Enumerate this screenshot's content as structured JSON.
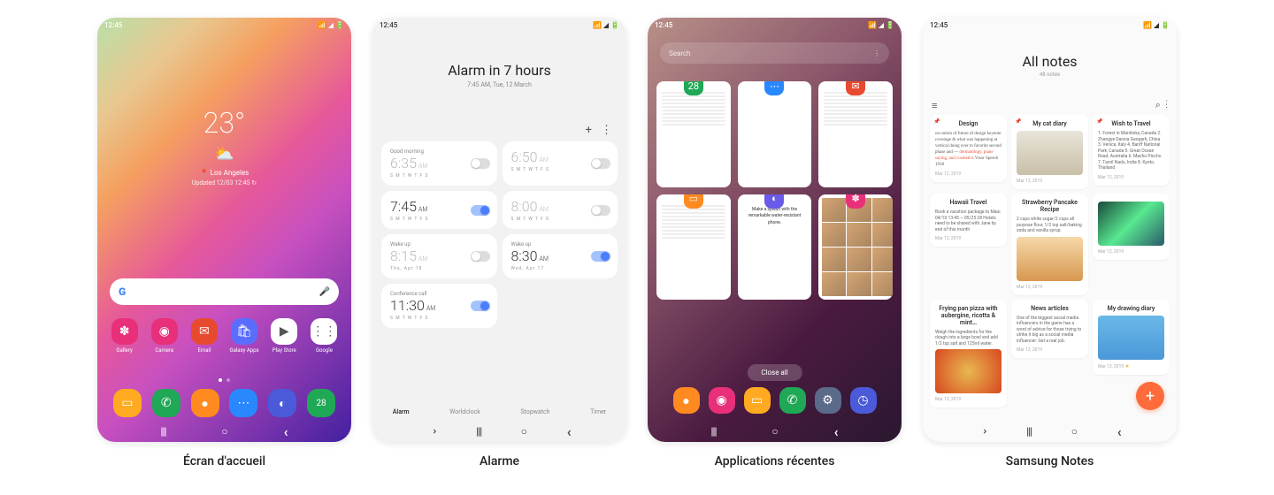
{
  "statusbar": {
    "time": "12:45"
  },
  "captions": {
    "home": "Écran d'accueil",
    "alarm": "Alarme",
    "recents": "Applications récentes",
    "notes": "Samsung Notes"
  },
  "home": {
    "weather": {
      "temp": "23°",
      "location": "Los Angeles",
      "updated": "Updated 12/03 12:45 ↻"
    },
    "apps": [
      {
        "label": "Gallery",
        "color": "#e8307a",
        "icon": "✽"
      },
      {
        "label": "Camera",
        "color": "#e8307a",
        "icon": "◉"
      },
      {
        "label": "Email",
        "color": "#e84a30",
        "icon": "✉"
      },
      {
        "label": "Galaxy Apps",
        "color": "#5a6dff",
        "icon": "🛍"
      },
      {
        "label": "Play Store",
        "color": "#fff",
        "icon": "▶"
      },
      {
        "label": "Google",
        "color": "#fff",
        "icon": "⋮⋮"
      }
    ],
    "dock": [
      {
        "color": "#ffaa20",
        "icon": "▭"
      },
      {
        "color": "#1fa855",
        "icon": "✆"
      },
      {
        "color": "#ff8a20",
        "icon": "●"
      },
      {
        "color": "#2a88ff",
        "icon": "⋯"
      },
      {
        "color": "#4a5ad8",
        "icon": "◐"
      },
      {
        "color": "#1fa855",
        "icon": "28"
      }
    ]
  },
  "alarm": {
    "title": "Alarm in 7 hours",
    "subtitle": "7:45 AM, Tue, 12 March",
    "tabs": [
      "Alarm",
      "Worldclock",
      "Stopwatch",
      "Timer"
    ],
    "activeTab": 0,
    "items": [
      {
        "label": "Good morning",
        "time": "6:35",
        "ampm": "AM",
        "days": "S M T W T F S",
        "on": false
      },
      {
        "label": "",
        "time": "6:50",
        "ampm": "AM",
        "days": "S M T W T F S",
        "on": false
      },
      {
        "label": "",
        "time": "7:45",
        "ampm": "AM",
        "days": "S M T W T F S",
        "on": true
      },
      {
        "label": "",
        "time": "8:00",
        "ampm": "AM",
        "days": "S M T W T F S",
        "on": false
      },
      {
        "label": "Wake up",
        "time": "8:15",
        "ampm": "AM",
        "days": "Thu, Apr 18",
        "on": false
      },
      {
        "label": "Wake up",
        "time": "8:30",
        "ampm": "AM",
        "days": "Wed, Apr 17",
        "on": true
      },
      {
        "label": "Conference call",
        "time": "11:30",
        "ampm": "AM",
        "days": "S M T W T F S",
        "on": true
      }
    ]
  },
  "recents": {
    "search": "Search",
    "closeAll": "Close all",
    "cards": [
      {
        "badge": "28",
        "color": "#1fa855",
        "type": "calendar"
      },
      {
        "badge": "⋯",
        "color": "#2a88ff",
        "type": "chat"
      },
      {
        "badge": "✉",
        "color": "#e84a30",
        "type": "email"
      },
      {
        "badge": "▭",
        "color": "#ff8a20",
        "type": "files"
      },
      {
        "badge": "◐",
        "color": "#6a5ae8",
        "type": "internet"
      },
      {
        "badge": "✽",
        "color": "#e8307a",
        "type": "gallery"
      }
    ],
    "dock": [
      {
        "color": "#ff8a20",
        "icon": "●"
      },
      {
        "color": "#e8307a",
        "icon": "◉"
      },
      {
        "color": "#ffaa20",
        "icon": "▭"
      },
      {
        "color": "#1fa855",
        "icon": "✆"
      },
      {
        "color": "#5a6a88",
        "icon": "⚙"
      },
      {
        "color": "#4a5ad8",
        "icon": "◷"
      }
    ]
  },
  "notes": {
    "title": "All notes",
    "count": "48 notes",
    "items": [
      {
        "pin": true,
        "title": "Design",
        "body": "on notion of future of design keynote coverage & what was happening at vertical doing over to favorite second phase and\n— dermatology, plane saying, and cosmetics\nVisor Speech 1918",
        "date": "Mar 12, 2019",
        "type": "hand"
      },
      {
        "pin": true,
        "title": "My cat diary",
        "img": "cat",
        "date": "Mar 12, 2019"
      },
      {
        "pin": true,
        "title": "Wish to Travel",
        "body": "1. Forest in Manitoba, Canada\n2. Zhangye Danxia Geopark, China\n3. Venice, Italy\n4. Banff National Park, Canada\n5. Great Ocean Road, Australia\n6. Machu Picchu\n7. Tamil Nadu, India\n8. Kyoto, Thailand",
        "date": "Mar 12, 2019",
        "type": "list"
      },
      {
        "title": "Hawaii Travel",
        "body": "Book a vacation package to Maui 04/10 13:45 ~ 05/25 28\nHotels need to be shared with Jane by end of this month",
        "date": "Mar 12, 2019",
        "type": "txt"
      },
      {
        "title": "Strawberry Pancake Recipe",
        "body": "2 cups white sugar/2 cups all purpose flour, 1/2 tsp salt/baking soda and vanilla syrup.",
        "img": "pancake",
        "date": "Mar 12, 2019"
      },
      {
        "img": "aurora",
        "date": "Mar 12, 2019",
        "body": ""
      },
      {
        "title": "Frying pan pizza with aubergine, ricotta & mint…",
        "body": "Weigh the ingredients for the dough into a large bowl and add 1/2 tsp salt and 125ml water.",
        "img": "pizza",
        "date": "Mar 12, 2019"
      },
      {
        "title": "News articles",
        "body": "One of the biggest social media influencers in the game has a word of advice for those trying to strike it big as a social media influencer: Get a real job.",
        "date": "Mar 12, 2019",
        "type": "txt"
      },
      {
        "title": "My drawing diary",
        "img": "drawing",
        "date": "Mar 12, 2019",
        "star": true
      }
    ]
  }
}
